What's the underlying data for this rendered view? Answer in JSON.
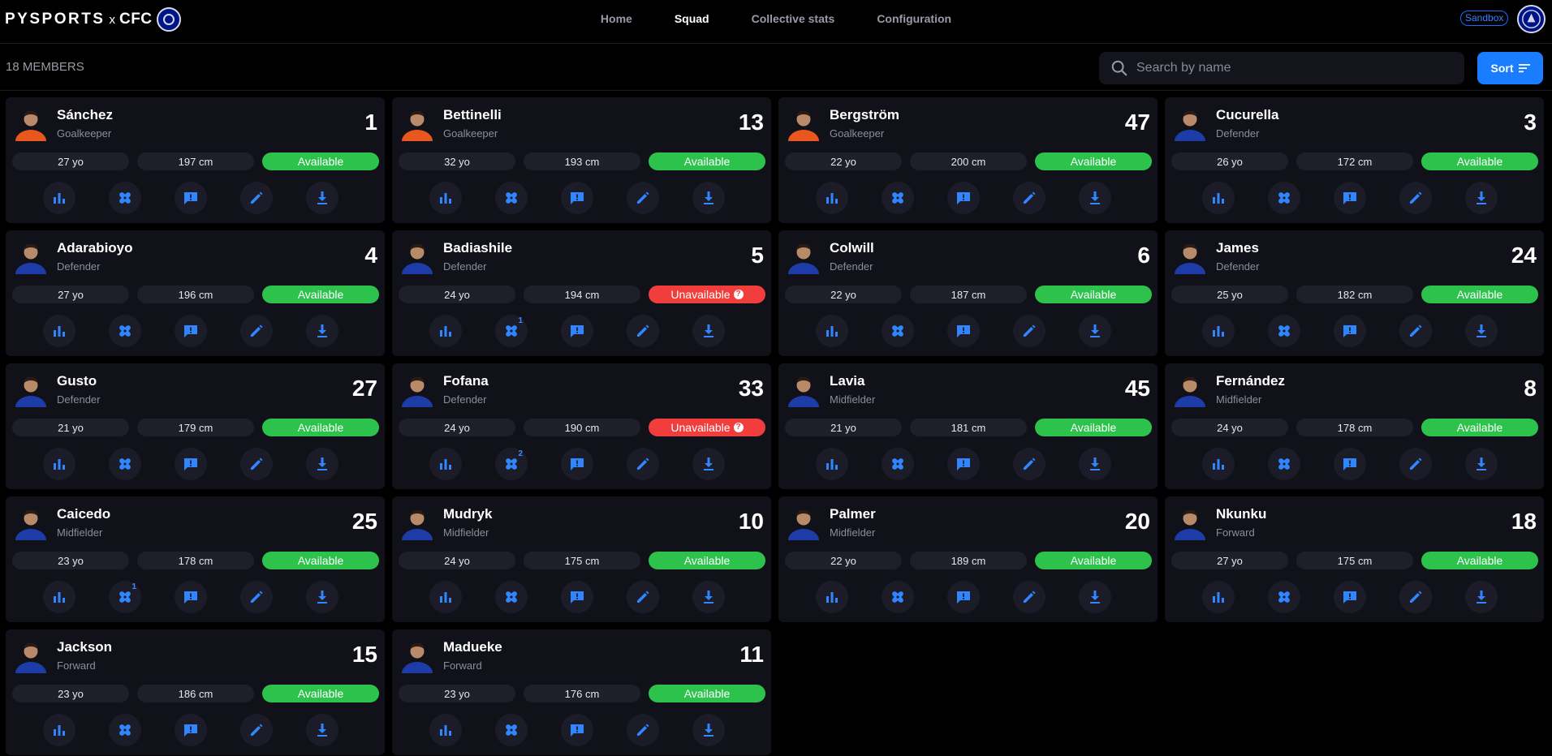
{
  "brand": {
    "py": "PYSPORTS",
    "x": "x",
    "cfc": "CFC"
  },
  "nav": {
    "home": "Home",
    "squad": "Squad",
    "collective": "Collective stats",
    "configuration": "Configuration"
  },
  "env_badge": "Sandbox",
  "toolbar": {
    "member_count": "18 MEMBERS",
    "search_placeholder": "Search by name",
    "sort_label": "Sort"
  },
  "colors": {
    "accent": "#1a7cff",
    "available": "#2cc24b",
    "unavailable": "#f23d3d",
    "card": "#11111a",
    "keeper_kit": "#e8571e",
    "outfield_kit": "#1d3ca8"
  },
  "icons": [
    "bar-chart-icon",
    "bandage-icon",
    "feedback-icon",
    "pencil-icon",
    "download-icon"
  ],
  "players": [
    {
      "name": "Sánchez",
      "position": "Goalkeeper",
      "number": "1",
      "age": "27 yo",
      "height": "197 cm",
      "status": "Available",
      "available": true,
      "injuries": ""
    },
    {
      "name": "Bettinelli",
      "position": "Goalkeeper",
      "number": "13",
      "age": "32 yo",
      "height": "193 cm",
      "status": "Available",
      "available": true,
      "injuries": ""
    },
    {
      "name": "Bergström",
      "position": "Goalkeeper",
      "number": "47",
      "age": "22 yo",
      "height": "200 cm",
      "status": "Available",
      "available": true,
      "injuries": ""
    },
    {
      "name": "Cucurella",
      "position": "Defender",
      "number": "3",
      "age": "26 yo",
      "height": "172 cm",
      "status": "Available",
      "available": true,
      "injuries": ""
    },
    {
      "name": "Adarabioyo",
      "position": "Defender",
      "number": "4",
      "age": "27 yo",
      "height": "196 cm",
      "status": "Available",
      "available": true,
      "injuries": ""
    },
    {
      "name": "Badiashile",
      "position": "Defender",
      "number": "5",
      "age": "24 yo",
      "height": "194 cm",
      "status": "Unavailable",
      "available": false,
      "injuries": "1"
    },
    {
      "name": "Colwill",
      "position": "Defender",
      "number": "6",
      "age": "22 yo",
      "height": "187 cm",
      "status": "Available",
      "available": true,
      "injuries": ""
    },
    {
      "name": "James",
      "position": "Defender",
      "number": "24",
      "age": "25 yo",
      "height": "182 cm",
      "status": "Available",
      "available": true,
      "injuries": ""
    },
    {
      "name": "Gusto",
      "position": "Defender",
      "number": "27",
      "age": "21 yo",
      "height": "179 cm",
      "status": "Available",
      "available": true,
      "injuries": ""
    },
    {
      "name": "Fofana",
      "position": "Defender",
      "number": "33",
      "age": "24 yo",
      "height": "190 cm",
      "status": "Unavailable",
      "available": false,
      "injuries": "2"
    },
    {
      "name": "Lavia",
      "position": "Midfielder",
      "number": "45",
      "age": "21 yo",
      "height": "181 cm",
      "status": "Available",
      "available": true,
      "injuries": ""
    },
    {
      "name": "Fernández",
      "position": "Midfielder",
      "number": "8",
      "age": "24 yo",
      "height": "178 cm",
      "status": "Available",
      "available": true,
      "injuries": ""
    },
    {
      "name": "Caicedo",
      "position": "Midfielder",
      "number": "25",
      "age": "23 yo",
      "height": "178 cm",
      "status": "Available",
      "available": true,
      "injuries": "1"
    },
    {
      "name": "Mudryk",
      "position": "Midfielder",
      "number": "10",
      "age": "24 yo",
      "height": "175 cm",
      "status": "Available",
      "available": true,
      "injuries": ""
    },
    {
      "name": "Palmer",
      "position": "Midfielder",
      "number": "20",
      "age": "22 yo",
      "height": "189 cm",
      "status": "Available",
      "available": true,
      "injuries": ""
    },
    {
      "name": "Nkunku",
      "position": "Forward",
      "number": "18",
      "age": "27 yo",
      "height": "175 cm",
      "status": "Available",
      "available": true,
      "injuries": ""
    },
    {
      "name": "Jackson",
      "position": "Forward",
      "number": "15",
      "age": "23 yo",
      "height": "186 cm",
      "status": "Available",
      "available": true,
      "injuries": ""
    },
    {
      "name": "Madueke",
      "position": "Forward",
      "number": "11",
      "age": "23 yo",
      "height": "176 cm",
      "status": "Available",
      "available": true,
      "injuries": ""
    }
  ]
}
